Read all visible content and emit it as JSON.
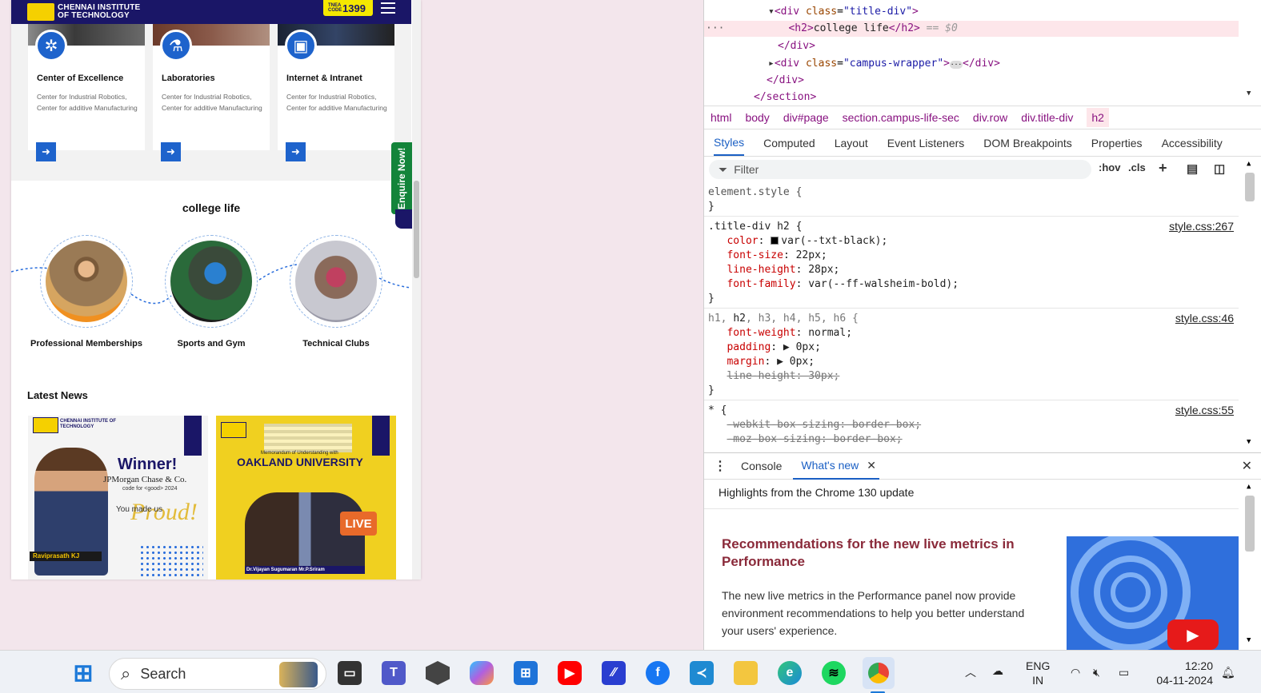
{
  "site": {
    "header": {
      "institute": "CHENNAI INSTITUTE OF TECHNOLOGY",
      "tnea_label": "TNEA CODE",
      "tnea_code": "1399"
    },
    "facilities": [
      {
        "title": "Center of Excellence",
        "desc": "Center for Industrial Robotics, Center for additive Manufacturing",
        "icon": "excellence-icon"
      },
      {
        "title": "Laboratories",
        "desc": "Center for Industrial Robotics, Center for additive Manufacturing",
        "icon": "microscope-icon"
      },
      {
        "title": "Internet & Intranet",
        "desc": "Center for Industrial Robotics, Center for additive Manufacturing",
        "icon": "network-icon"
      }
    ],
    "enquire": "Enquire Now!",
    "college_life": {
      "title": "college life",
      "items": [
        "Professional Memberships",
        "Sports and Gym",
        "Technical Clubs"
      ]
    },
    "news": {
      "title": "Latest News",
      "card1": {
        "winner": "Winner!",
        "company": "JPMorgan Chase & Co.",
        "code": "code for <good> 2024",
        "made": "You made us",
        "proud": "Proud!",
        "name": "Raviprasath KJ"
      },
      "card2": {
        "memo": "Memorandum of Understanding with",
        "university": "OAKLAND UNIVERSITY",
        "live": "LIVE",
        "names": "Dr.Vijayan Sugumaran        Mr.P.Sriram"
      }
    }
  },
  "devtools": {
    "elements": {
      "line1": {
        "tag_open": "<div ",
        "attr": "class",
        "val": "\"title-div\"",
        "close": ">"
      },
      "line2": {
        "open": "<h2>",
        "text": "college life",
        "close": "</h2>",
        "suffix": " == $0"
      },
      "line3": "</div>",
      "line4": {
        "tag_open": "<div ",
        "attr": "class",
        "val": "\"campus-wrapper\"",
        "close": ">",
        "end": "</div>"
      },
      "line5": "</div>",
      "line6": "</section>"
    },
    "breadcrumbs": [
      "html",
      "body",
      "div#page",
      "section.campus-life-sec",
      "div.row",
      "div.title-div",
      "h2"
    ],
    "tabs": [
      "Styles",
      "Computed",
      "Layout",
      "Event Listeners",
      "DOM Breakpoints",
      "Properties",
      "Accessibility"
    ],
    "filter_placeholder": "Filter",
    "hov": ":hov",
    "cls": ".cls",
    "styles": {
      "element_style": "element.style {",
      "rule1": {
        "selector": ".title-div h2 {",
        "source": "style.css:267",
        "props": [
          [
            "color",
            "var(--txt-black);"
          ],
          [
            "font-size",
            "22px;"
          ],
          [
            "line-height",
            "28px;"
          ],
          [
            "font-family",
            "var(--ff-walsheim-bold);"
          ]
        ]
      },
      "rule2": {
        "selector_dim1": "h1, ",
        "selector_main": "h2",
        "selector_dim2": ", h3, h4, h5, h6 {",
        "source": "style.css:46",
        "props": [
          [
            "font-weight",
            "normal;"
          ],
          [
            "padding",
            "0px;"
          ],
          [
            "margin",
            "0px;"
          ]
        ],
        "struck": "line-height: 30px;"
      },
      "rule3": {
        "selector": "* {",
        "source": "style.css:55",
        "struck1": "-webkit-box-sizing: border-box;",
        "struck2": "-moz-box-sizing: border-box;"
      }
    },
    "drawer": {
      "console": "Console",
      "whats_new": "What's new"
    },
    "whats_new": {
      "heading": "Highlights from the Chrome 130 update",
      "title": "Recommendations for the new live metrics in Performance",
      "body": "The new live metrics in the Performance panel now provide environment recommendations to help you better understand your users' experience."
    }
  },
  "taskbar": {
    "search": "Search",
    "lang1": "ENG",
    "lang2": "IN",
    "time": "12:20",
    "date": "04-11-2024"
  }
}
